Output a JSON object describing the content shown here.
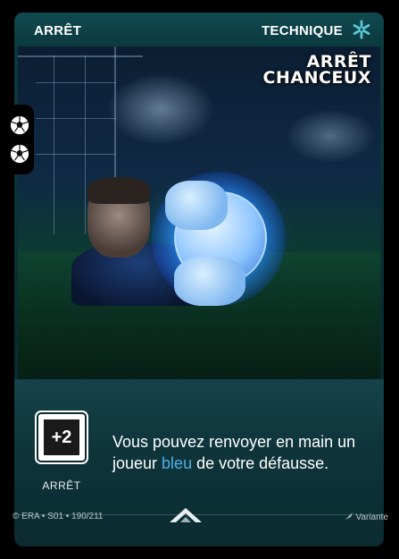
{
  "card": {
    "type_label": "ARRÊT",
    "category_label": "TECHNIQUE",
    "category_icon": "snowflake-icon",
    "title_line1": "ARRÊT",
    "title_line2": "CHANCEUX",
    "tokens": [
      "soccer-ball-icon",
      "soccer-ball-icon"
    ],
    "power_value": "+2",
    "power_label": "ARRÊT",
    "effect_before": "Vous pouvez renvoyer en main un joueur ",
    "effect_highlight": "bleu",
    "effect_after": " de votre défausse.",
    "copyright": "© ERA • S01 • 190/211",
    "variant": "Variante"
  },
  "colors": {
    "card_bg": "#0d3a40",
    "highlight_blue": "#4fb0e8",
    "icon_cyan": "#5ec8d8"
  }
}
